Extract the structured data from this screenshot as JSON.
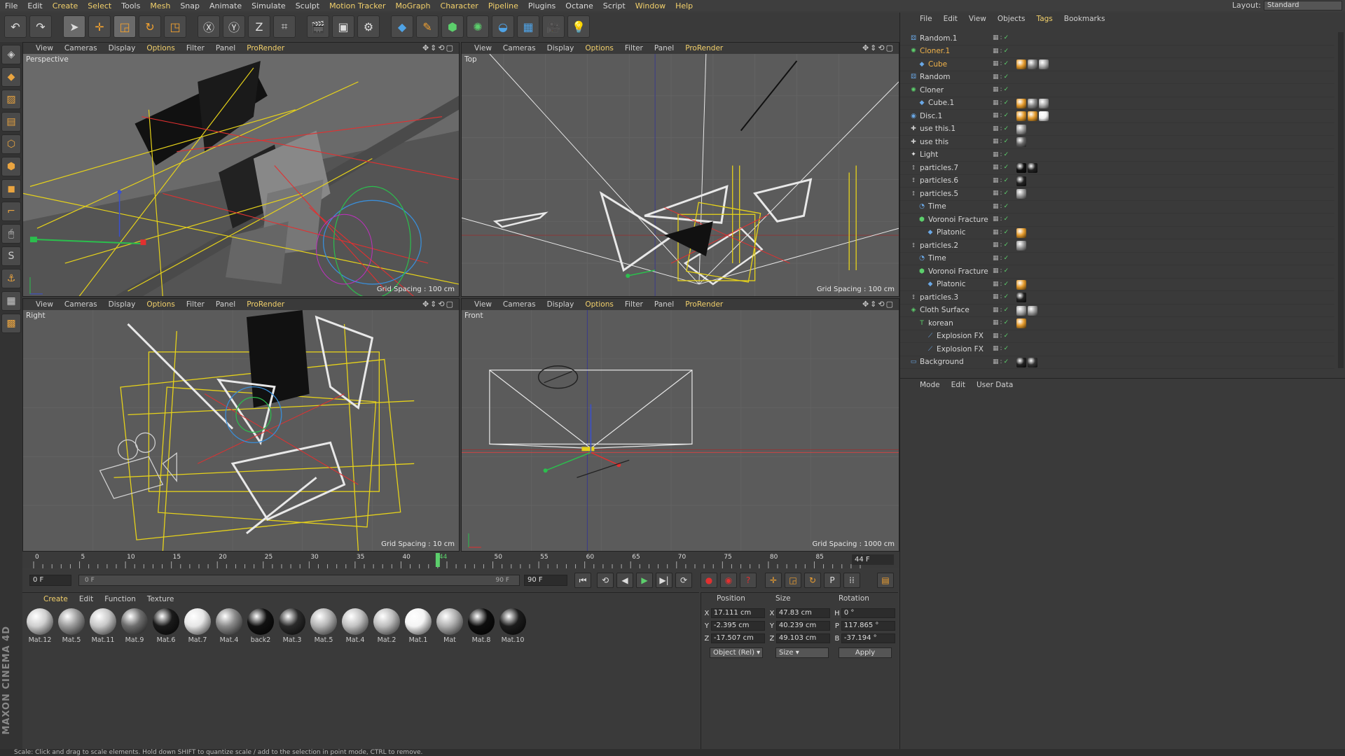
{
  "menubar": {
    "items": [
      "File",
      "Edit",
      "Create",
      "Select",
      "Tools",
      "Mesh",
      "Snap",
      "Animate",
      "Simulate",
      "Sculpt",
      "Motion Tracker",
      "MoGraph",
      "Character",
      "Pipeline",
      "Plugins",
      "Octane",
      "Script",
      "Window",
      "Help"
    ],
    "layout_label": "Layout:",
    "layout_value": "Standard"
  },
  "viewports": [
    {
      "name": "Perspective",
      "grid": "Grid Spacing : 100 cm"
    },
    {
      "name": "Top",
      "grid": "Grid Spacing : 100 cm"
    },
    {
      "name": "Right",
      "grid": "Grid Spacing : 10 cm"
    },
    {
      "name": "Front",
      "grid": "Grid Spacing : 1000 cm"
    }
  ],
  "viewport_menu": [
    "View",
    "Cameras",
    "Display",
    "Options",
    "Filter",
    "Panel",
    "ProRender"
  ],
  "timeline": {
    "ticks": [
      "0",
      "5",
      "10",
      "15",
      "20",
      "25",
      "30",
      "35",
      "40",
      "44",
      "50",
      "55",
      "60",
      "65",
      "70",
      "75",
      "80",
      "85",
      "90"
    ],
    "current_frame": "44 F"
  },
  "transport": {
    "start": "0 F",
    "slider_start": "0 F",
    "slider_end": "90 F",
    "end": "90 F"
  },
  "material_menu": [
    "Create",
    "Edit",
    "Function",
    "Texture"
  ],
  "materials": [
    {
      "name": "Mat.12",
      "color": "#cfcfcf"
    },
    {
      "name": "Mat.5",
      "color": "#9a9a9a"
    },
    {
      "name": "Mat.11",
      "color": "#c8c8c8"
    },
    {
      "name": "Mat.9",
      "color": "#6e6e6e"
    },
    {
      "name": "Mat.6",
      "color": "#1a1a1a"
    },
    {
      "name": "Mat.7",
      "color": "#e6e6e6"
    },
    {
      "name": "Mat.4",
      "color": "#8a8a8a"
    },
    {
      "name": "back2",
      "color": "#111111"
    },
    {
      "name": "Mat.3",
      "color": "#2a2a2a"
    },
    {
      "name": "Mat.5",
      "color": "#b5b5b5"
    },
    {
      "name": "Mat.4",
      "color": "#c2c2c2"
    },
    {
      "name": "Mat.2",
      "color": "#bdbdbd"
    },
    {
      "name": "Mat.1",
      "color": "#f4f4f4"
    },
    {
      "name": "Mat",
      "color": "#b0b0b0"
    },
    {
      "name": "Mat.8",
      "color": "#0d0d0d"
    },
    {
      "name": "Mat.10",
      "color": "#1c1c1c"
    }
  ],
  "coords": {
    "headers": [
      "Position",
      "Size",
      "Rotation"
    ],
    "rows": [
      {
        "axis": "X",
        "pos": "17.111 cm",
        "size_axis": "X",
        "size": "47.83 cm",
        "rot_axis": "H",
        "rot": "0 °"
      },
      {
        "axis": "Y",
        "pos": "-2.395 cm",
        "size_axis": "Y",
        "size": "40.239 cm",
        "rot_axis": "P",
        "rot": "117.865 °"
      },
      {
        "axis": "Z",
        "pos": "-17.507 cm",
        "size_axis": "Z",
        "size": "49.103 cm",
        "rot_axis": "B",
        "rot": "-37.194 °"
      }
    ],
    "mode": "Object (Rel)",
    "size_mode": "Size",
    "apply": "Apply"
  },
  "object_menu": [
    "File",
    "Edit",
    "View",
    "Objects",
    "Tags",
    "Bookmarks"
  ],
  "objects": [
    {
      "name": "Random.1",
      "indent": 0,
      "sel": false,
      "icon": "random-icon",
      "tags": []
    },
    {
      "name": "Cloner.1",
      "indent": 0,
      "sel": true,
      "icon": "cloner-icon",
      "tags": []
    },
    {
      "name": "Cube",
      "indent": 1,
      "sel": true,
      "icon": "cube-icon",
      "tags": [
        "#e39a2c",
        "#888",
        "#aaa"
      ]
    },
    {
      "name": "Random",
      "indent": 0,
      "sel": false,
      "icon": "random-icon",
      "tags": []
    },
    {
      "name": "Cloner",
      "indent": 0,
      "sel": false,
      "icon": "cloner-icon",
      "tags": []
    },
    {
      "name": "Cube.1",
      "indent": 1,
      "sel": false,
      "icon": "cube-icon",
      "tags": [
        "#e39a2c",
        "#888",
        "#aaa"
      ]
    },
    {
      "name": "Disc.1",
      "indent": 0,
      "sel": false,
      "icon": "disc-icon",
      "tags": [
        "#e39a2c",
        "#e39a2c",
        "#f0f0f0"
      ]
    },
    {
      "name": "use this.1",
      "indent": 0,
      "sel": false,
      "icon": "null-icon",
      "tags": [
        "#999"
      ]
    },
    {
      "name": "use this",
      "indent": 0,
      "sel": false,
      "icon": "null-icon",
      "tags": [
        "#666"
      ]
    },
    {
      "name": "Light",
      "indent": 0,
      "sel": false,
      "icon": "light-icon",
      "tags": []
    },
    {
      "name": "particles.7",
      "indent": 0,
      "sel": false,
      "icon": "emitter-icon",
      "tags": [
        "#111",
        "#222"
      ]
    },
    {
      "name": "particles.6",
      "indent": 0,
      "sel": false,
      "icon": "emitter-icon",
      "tags": [
        "#222"
      ]
    },
    {
      "name": "particles.5",
      "indent": 0,
      "sel": false,
      "icon": "emitter-icon",
      "tags": [
        "#999"
      ]
    },
    {
      "name": "Time",
      "indent": 1,
      "sel": false,
      "icon": "time-icon",
      "tags": []
    },
    {
      "name": "Voronoi Fracture",
      "indent": 1,
      "sel": false,
      "icon": "voronoi-icon",
      "tags": []
    },
    {
      "name": "Platonic",
      "indent": 2,
      "sel": false,
      "icon": "platonic-icon",
      "tags": [
        "#e39a2c"
      ]
    },
    {
      "name": "particles.2",
      "indent": 0,
      "sel": false,
      "icon": "emitter-icon",
      "tags": [
        "#999"
      ]
    },
    {
      "name": "Time",
      "indent": 1,
      "sel": false,
      "icon": "time-icon",
      "tags": []
    },
    {
      "name": "Voronoi Fracture",
      "indent": 1,
      "sel": false,
      "icon": "voronoi-icon",
      "tags": []
    },
    {
      "name": "Platonic",
      "indent": 2,
      "sel": false,
      "icon": "platonic-icon",
      "tags": [
        "#e39a2c"
      ]
    },
    {
      "name": "particles.3",
      "indent": 0,
      "sel": false,
      "icon": "emitter-icon",
      "tags": [
        "#222"
      ]
    },
    {
      "name": "Cloth Surface",
      "indent": 0,
      "sel": false,
      "icon": "cloth-icon",
      "tags": [
        "#aaa",
        "#999"
      ]
    },
    {
      "name": "korean",
      "indent": 1,
      "sel": false,
      "icon": "text-icon",
      "tags": [
        "#e39a2c"
      ]
    },
    {
      "name": "Explosion FX",
      "indent": 2,
      "sel": false,
      "icon": "explosion-icon",
      "tags": []
    },
    {
      "name": "Explosion FX",
      "indent": 2,
      "sel": false,
      "icon": "explosion-icon",
      "tags": []
    },
    {
      "name": "Background",
      "indent": 0,
      "sel": false,
      "icon": "background-icon",
      "tags": [
        "#222",
        "#333"
      ]
    }
  ],
  "attr_menu": [
    "Mode",
    "Edit",
    "User Data"
  ],
  "status": "Scale: Click and drag to scale elements. Hold down SHIFT to quantize scale / add to the selection in point mode, CTRL to remove.",
  "brand": "MAXON CINEMA 4D"
}
